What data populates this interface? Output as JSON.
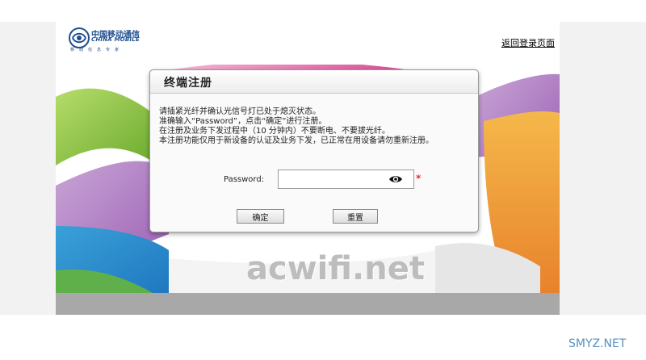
{
  "header": {
    "logo_cn": "中国移动通信",
    "logo_en": "CHINA MOBILE",
    "logo_tagline": "移动信息专家",
    "back_link": "返回登录页面"
  },
  "dialog": {
    "title": "终端注册",
    "notes": [
      "请插紧光纤并确认光信号灯已处于熄灭状态。",
      "准确输入“Password”，点击“确定”进行注册。",
      "在注册及业务下发过程中（10 分钟内）不要断电、不要拔光纤。",
      "本注册功能仅用于新设备的认证及业务下发，已正常在用设备请勿重新注册。"
    ],
    "password_label": "Password:",
    "password_value": "",
    "required_mark": "*",
    "ok_label": "确定",
    "reset_label": "重置"
  },
  "watermark": "acwifi.net",
  "corner_mark": "SMYZ.NET",
  "colors": {
    "brand_blue": "#1f4f8f",
    "required_red": "#e03030",
    "footer_gray": "#a8a8a8"
  },
  "icons": {
    "logo": "china-mobile-logo-icon",
    "eye": "eye-icon"
  }
}
